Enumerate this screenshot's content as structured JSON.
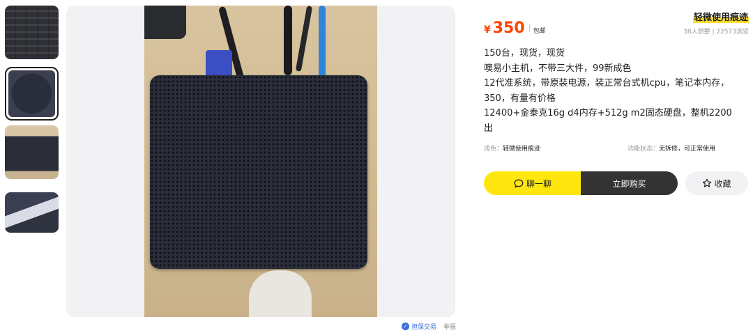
{
  "gallery": {
    "thumbnails": [
      {
        "label": "thumbnail-1"
      },
      {
        "label": "thumbnail-2",
        "selected": true
      },
      {
        "label": "thumbnail-3"
      },
      {
        "label": "thumbnail-4"
      }
    ]
  },
  "main_image": {
    "safe_trade_label": "担保交易",
    "report_label": "举报"
  },
  "listing": {
    "currency": "¥",
    "price": "350",
    "shipping": "包邮",
    "condition_badge": "轻微使用痕迹",
    "stats": "38人想要 | 22573浏览",
    "description": [
      "150台，现货，现货",
      "噢易小主机，不带三大件，99新成色",
      "12代准系统，带原装电源，装正常台式机cpu，笔记本内存，",
      "350，有量有价格",
      "12400+金泰克16g d4内存+512g m2固态硬盘，整机2200",
      "出"
    ],
    "attributes": {
      "condition": {
        "key": "成色：",
        "value": "轻微使用痕迹"
      },
      "function": {
        "key": "功能状态：",
        "value": "无拆修，可正常使用"
      }
    }
  },
  "actions": {
    "chat_label": "聊一聊",
    "buy_label": "立即购买",
    "favorite_label": "收藏"
  },
  "colors": {
    "price": "#ff4400",
    "chat_button": "#ffe60f",
    "buy_button": "#333333",
    "safe_trade": "#3a6fd8"
  }
}
